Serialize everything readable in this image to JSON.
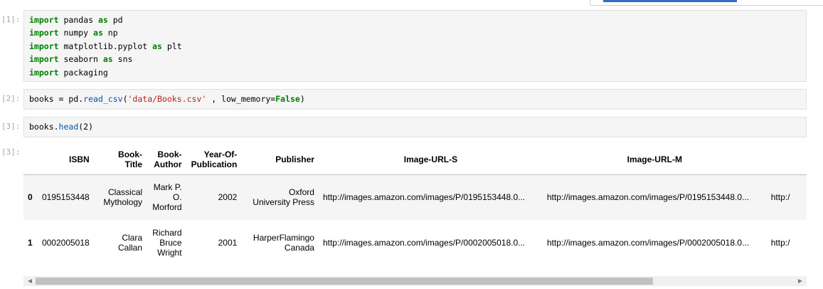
{
  "cells": [
    {
      "prompt": "[1]:",
      "lines": [
        [
          {
            "t": "import",
            "k": "kw"
          },
          {
            "t": " pandas "
          },
          {
            "t": "as",
            "k": "kw"
          },
          {
            "t": " pd"
          }
        ],
        [
          {
            "t": "import",
            "k": "kw"
          },
          {
            "t": " numpy "
          },
          {
            "t": "as",
            "k": "kw"
          },
          {
            "t": " np"
          }
        ],
        [
          {
            "t": "import",
            "k": "kw"
          },
          {
            "t": " matplotlib.pyplot "
          },
          {
            "t": "as",
            "k": "kw"
          },
          {
            "t": " plt"
          }
        ],
        [
          {
            "t": "import",
            "k": "kw"
          },
          {
            "t": " seaborn "
          },
          {
            "t": "as",
            "k": "kw"
          },
          {
            "t": " sns"
          }
        ],
        [
          {
            "t": "import",
            "k": "kw"
          },
          {
            "t": " packaging"
          }
        ]
      ]
    },
    {
      "prompt": "[2]:",
      "lines": [
        [
          {
            "t": "books = pd."
          },
          {
            "t": "read_csv",
            "k": "fn"
          },
          {
            "t": "("
          },
          {
            "t": "'data/Books.csv'",
            "k": "str"
          },
          {
            "t": " , low_memory="
          },
          {
            "t": "False",
            "k": "bool"
          },
          {
            "t": ")"
          }
        ]
      ]
    },
    {
      "prompt": "[3]:",
      "lines": [
        [
          {
            "t": "books."
          },
          {
            "t": "head",
            "k": "fn"
          },
          {
            "t": "(2)"
          }
        ]
      ]
    }
  ],
  "output": {
    "prompt": "[3]:",
    "columns": [
      "ISBN",
      "Book-\nTitle",
      "Book-\nAuthor",
      "Year-Of-\nPublication",
      "Publisher",
      "Image-URL-S",
      "Image-URL-M",
      ""
    ],
    "rows": [
      {
        "index": "0",
        "cells": [
          "0195153448",
          "Classical\nMythology",
          "Mark P.\nO.\nMorford",
          "2002",
          "Oxford\nUniversity Press",
          "http://images.amazon.com/images/P/0195153448.0...",
          "http://images.amazon.com/images/P/0195153448.0...",
          "http:/"
        ]
      },
      {
        "index": "1",
        "cells": [
          "0002005018",
          "Clara\nCallan",
          "Richard\nBruce\nWright",
          "2001",
          "HarperFlamingo\nCanada",
          "http://images.amazon.com/images/P/0002005018.0...",
          "http://images.amazon.com/images/P/0002005018.0...",
          "http:/"
        ]
      }
    ]
  },
  "colors": {
    "keyword": "#008000",
    "string": "#ba2121",
    "function": "#0055aa",
    "cell_bg": "#f5f5f5",
    "prompt": "#a6a6a6"
  }
}
